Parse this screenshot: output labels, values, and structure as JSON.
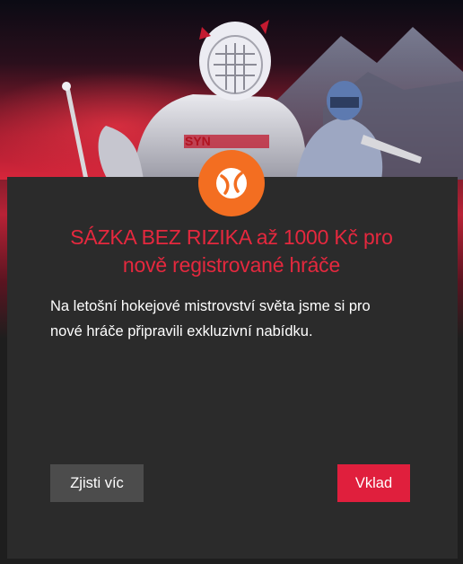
{
  "promo": {
    "headline_line1": "SÁZKA BEZ RIZIKA až 1000 Kč pro",
    "headline_line2": "nově registrované hráče",
    "body_line1": "Na letošní hokejové mistrovství světa jsme si pro",
    "body_line2": "nové hráče připravili exkluzivní nabídku.",
    "jersey_text": "SYN"
  },
  "buttons": {
    "more_label": "Zjisti víc",
    "deposit_label": "Vklad"
  },
  "icons": {
    "logo": "brand-logo-icon"
  },
  "colors": {
    "accent_red": "#e5283e",
    "deposit_button": "#e01f3d",
    "secondary_button": "#4c4c4c",
    "panel_bg": "#2b2b2b",
    "logo_orange": "#f36e21"
  }
}
